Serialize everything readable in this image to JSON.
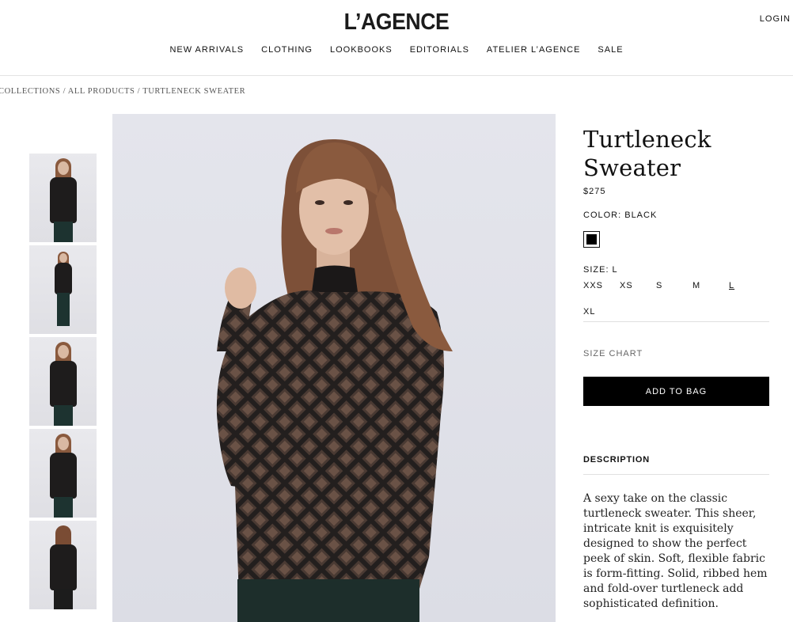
{
  "header": {
    "logo": "L’AGENCE",
    "login": "LOGIN",
    "nav": [
      "NEW ARRIVALS",
      "CLOTHING",
      "LOOKBOOKS",
      "EDITORIALS",
      "ATELIER L’AGENCE",
      "SALE"
    ]
  },
  "breadcrumb": "COLLECTIONS / ALL PRODUCTS / TURTLENECK SWEATER",
  "product": {
    "title_line1": "Turtleneck",
    "title_line2": "Sweater",
    "price": "$275",
    "color_label": "COLOR: BLACK",
    "swatch_color": "#000000",
    "size_label": "SIZE: L",
    "sizes": [
      "XXS",
      "XS",
      "S",
      "M",
      "L",
      "XL"
    ],
    "selected_size": "L",
    "size_chart": "SIZE CHART",
    "add_to_bag": "ADD TO BAG",
    "description_label": "DESCRIPTION",
    "description": "A sexy take on the classic turtleneck sweater. This sheer, intricate knit is exquisitely designed to show the perfect peek of skin. Soft, flexible fabric is form-fitting. Solid, ribbed hem and fold-over turtleneck add sophisticated definition."
  },
  "gallery": {
    "thumbnail_count": 5,
    "image_subject": "model-in-black-sheer-turtleneck"
  }
}
